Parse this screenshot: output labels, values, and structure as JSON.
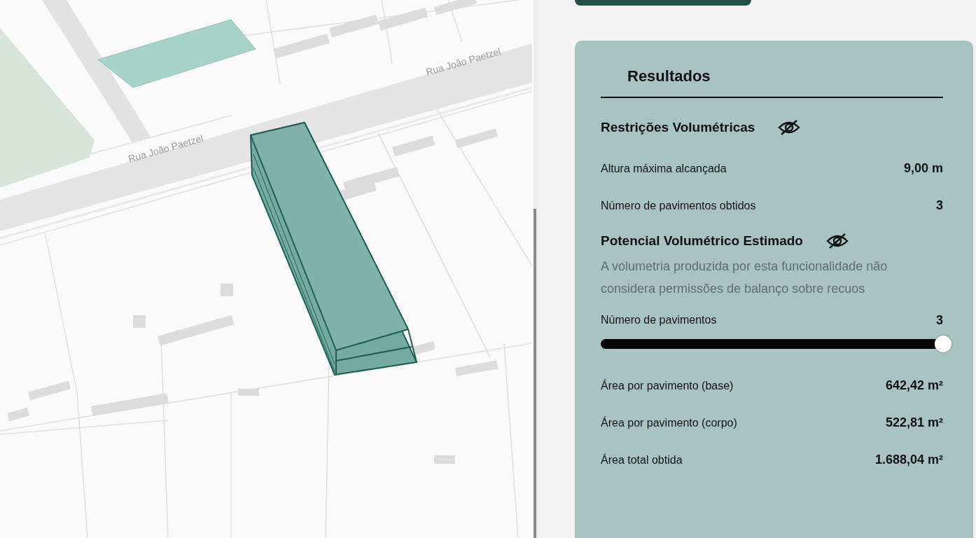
{
  "map": {
    "street_labels": [
      "Rua João Paetzel",
      "Rua João Paetzel"
    ]
  },
  "results": {
    "title": "Resultados",
    "sections": [
      {
        "title": "Restrições Volumétricas",
        "visible": false,
        "rows": [
          {
            "label": "Altura máxima alcançada",
            "value": "9,00 m"
          },
          {
            "label": "Número de pavimentos obtidos",
            "value": "3"
          }
        ]
      },
      {
        "title": "Potencial Volumétrico Estimado",
        "visible": false,
        "note": "A volumetria produzida por esta funcionalidade não considera permissões de balanço sobre recuos",
        "slider": {
          "label": "Número de pavimentos",
          "reading": "3",
          "level": 1
        },
        "rows": [
          {
            "label": "Área por pavimento (base)",
            "value": "642,42 m²"
          },
          {
            "label": "Área por pavimento (corpo)",
            "value": "522,81 m²"
          },
          {
            "label": "Área total obtida",
            "value": "1.688,04 m²"
          }
        ]
      }
    ]
  }
}
